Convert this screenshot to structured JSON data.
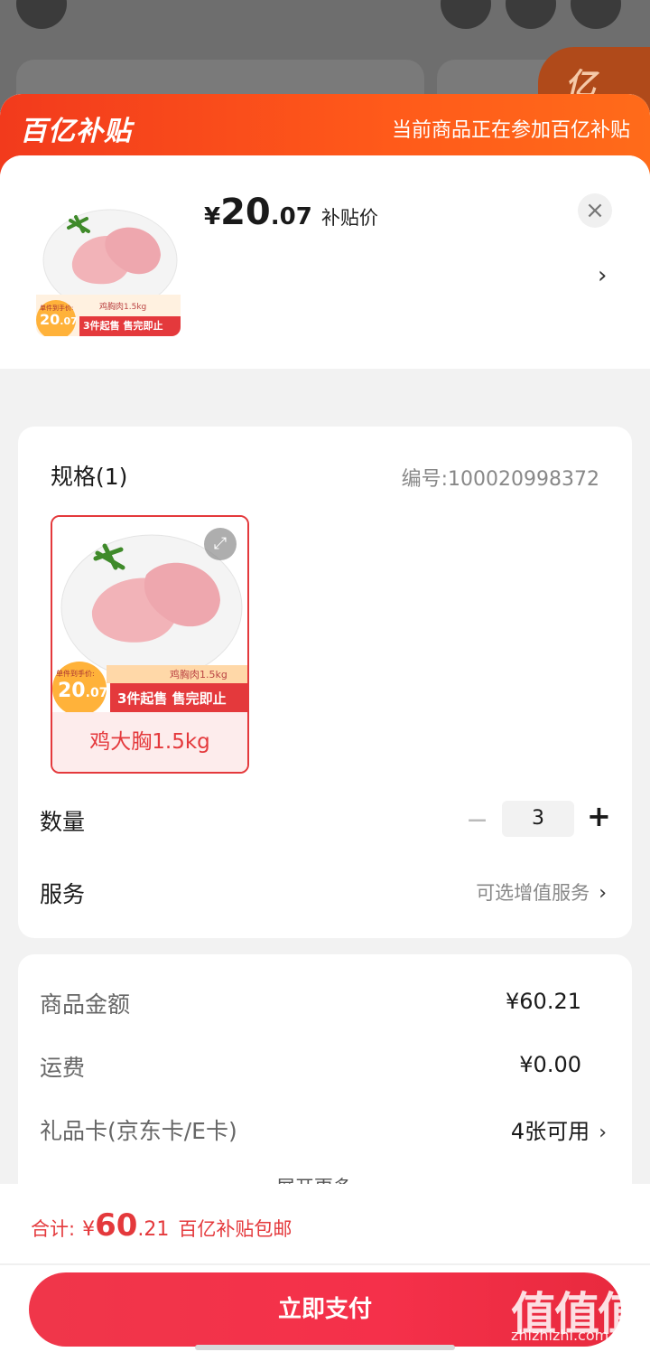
{
  "banner": {
    "logo": "百亿补贴",
    "text": "当前商品正在参加百亿补贴"
  },
  "product": {
    "price_yen": "¥",
    "price_int": "20",
    "price_dec": ".07",
    "price_tag": "补贴价",
    "thumb_caption": "鸡胸肉1.5kg",
    "thumb_unit_label": "单件到手价:",
    "thumb_price_int": "20",
    "thumb_price_dec": ".07",
    "thumb_promo": "3件起售 售完即止",
    "close_label": "×",
    "more_arrow": "›"
  },
  "spec": {
    "title": "规格(1)",
    "code": "编号:100020998372",
    "item_label": "鸡大胸1.5kg",
    "expand_icon": "⤢"
  },
  "quantity": {
    "label": "数量",
    "minus": "−",
    "value": "3",
    "plus": "+"
  },
  "service": {
    "label": "服务",
    "hint": "可选增值服务",
    "chevron": "›"
  },
  "costs": {
    "goods_label": "商品金额",
    "goods_value": "¥60.21",
    "shipping_label": "运费",
    "shipping_value": "¥0.00",
    "gift_label": "礼品卡(京东卡/E卡)",
    "gift_value": "4张可用",
    "gift_chevron": "›",
    "more": "展开更多 ⌄"
  },
  "footer": {
    "total_label": "合计:",
    "total_yen": "¥",
    "total_int": "60",
    "total_dec": ".21",
    "total_note": "百亿补贴包邮",
    "pay_button": "立即支付"
  },
  "watermark": {
    "main": "值值值",
    "sub": "zhizhizhi.com"
  },
  "colors": {
    "accent": "#e4393c",
    "banner": "#ff5a1a"
  }
}
